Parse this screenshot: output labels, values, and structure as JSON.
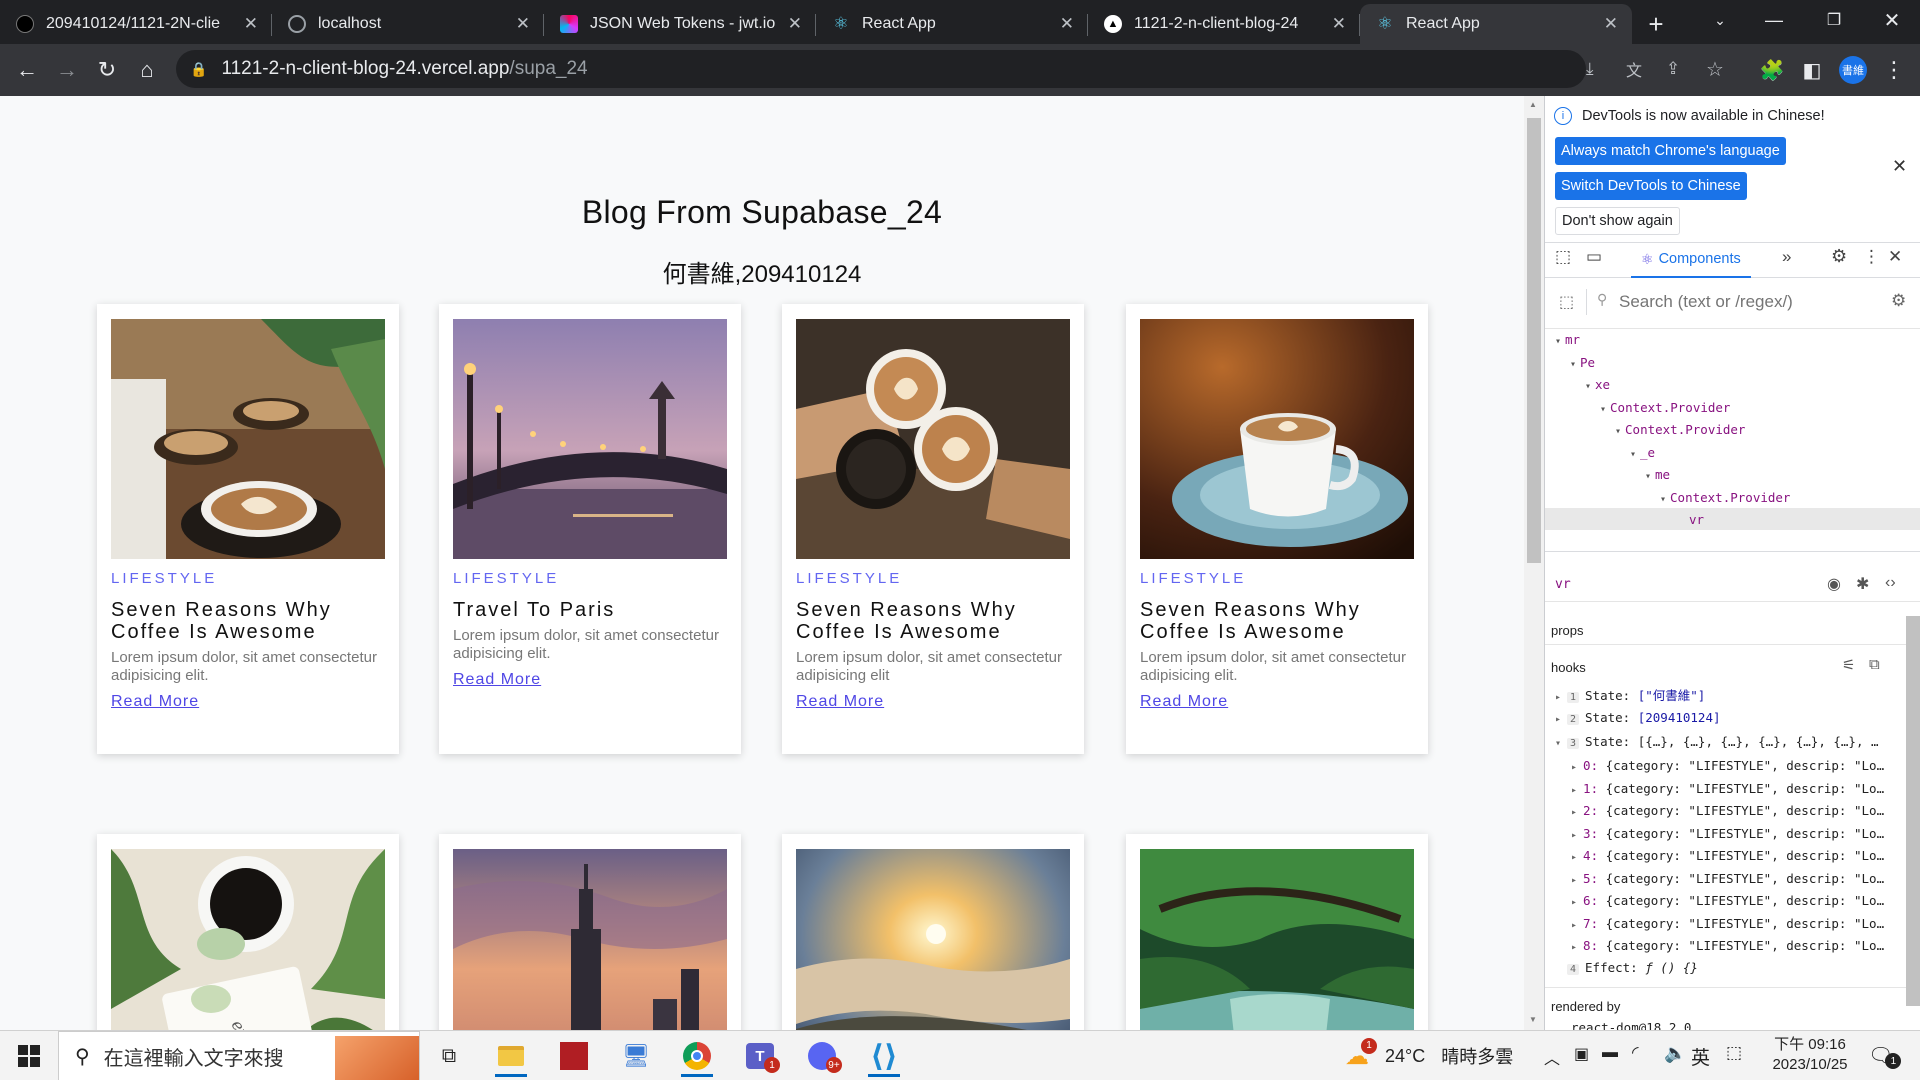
{
  "browser": {
    "tabs": [
      {
        "label": "209410124/1121-2N-clie",
        "icon": "github-icon",
        "active": false
      },
      {
        "label": "localhost",
        "icon": "globe-icon",
        "active": false
      },
      {
        "label": "JSON Web Tokens - jwt.io",
        "icon": "jwt-icon",
        "active": false
      },
      {
        "label": "React App",
        "icon": "react-icon",
        "active": false
      },
      {
        "label": "1121-2-n-client-blog-24",
        "icon": "vercel-icon",
        "active": false
      },
      {
        "label": "React App",
        "icon": "react-icon",
        "active": true
      }
    ],
    "url_host": "1121-2-n-client-blog-24.vercel.app",
    "url_path": "/supa_24",
    "profile_badge": "書維"
  },
  "page": {
    "title": "Blog From Supabase_24",
    "subtitle": "何書維,209410124",
    "cards": [
      {
        "category": "LIFESTYLE",
        "title": "Seven Reasons Why Coffee Is Awesome",
        "desc": "Lorem ipsum dolor, sit amet consectetur adipisicing elit.",
        "link": "Read More",
        "image": "coffee-latte-art"
      },
      {
        "category": "LIFESTYLE",
        "title": "Travel To Paris",
        "desc": "Lorem ipsum dolor, sit amet consectetur adipisicing elit.",
        "link": "Read More",
        "image": "paris-bridge-dusk"
      },
      {
        "category": "LIFESTYLE",
        "title": "Seven Reasons Why Coffee Is Awesome",
        "desc": "Lorem ipsum dolor, sit amet consectetur adipisicing elit",
        "link": "Read More",
        "image": "coffee-cheers"
      },
      {
        "category": "LIFESTYLE",
        "title": "Seven Reasons Why Coffee Is Awesome",
        "desc": "Lorem ipsum dolor, sit amet consectetur adipisicing elit.",
        "link": "Read More",
        "image": "coffee-cup-blue"
      },
      {
        "image": "coffee-leaves"
      },
      {
        "image": "taipei-101-sunset"
      },
      {
        "image": "sunrise-clouds"
      },
      {
        "image": "green-tree-river"
      }
    ]
  },
  "devtools": {
    "banner": "DevTools is now available in Chinese!",
    "btn_match": "Always match Chrome's language",
    "btn_switch": "Switch DevTools to Chinese",
    "btn_dont": "Don't show again",
    "tab_components": "Components",
    "search_placeholder": "Search (text or /regex/)",
    "tree": [
      "mr",
      "Pe",
      "xe",
      "Context.Provider",
      "Context.Provider",
      "_e",
      "me",
      "Context.Provider",
      "vr"
    ],
    "selected": "vr",
    "props_label": "props",
    "hooks_label": "hooks",
    "hooks": [
      {
        "num": "1",
        "label": "State:",
        "value": "[\"何書維\"]"
      },
      {
        "num": "2",
        "label": "State:",
        "value": "[209410124]"
      },
      {
        "num": "3",
        "label": "State:",
        "value": "[{…}, {…}, {…}, {…}, {…}, {…}, …"
      }
    ],
    "items": [
      {
        "key": "0:",
        "value": "{category: \"LIFESTYLE\", descrip: \"Lo…"
      },
      {
        "key": "1:",
        "value": "{category: \"LIFESTYLE\", descrip: \"Lo…"
      },
      {
        "key": "2:",
        "value": "{category: \"LIFESTYLE\", descrip: \"Lo…"
      },
      {
        "key": "3:",
        "value": "{category: \"LIFESTYLE\", descrip: \"Lo…"
      },
      {
        "key": "4:",
        "value": "{category: \"LIFESTYLE\", descrip: \"Lo…"
      },
      {
        "key": "5:",
        "value": "{category: \"LIFESTYLE\", descrip: \"Lo…"
      },
      {
        "key": "6:",
        "value": "{category: \"LIFESTYLE\", descrip: \"Lo…"
      },
      {
        "key": "7:",
        "value": "{category: \"LIFESTYLE\", descrip: \"Lo…"
      },
      {
        "key": "8:",
        "value": "{category: \"LIFESTYLE\", descrip: \"Lo…"
      }
    ],
    "effect": {
      "num": "4",
      "label": "Effect:",
      "value": "ƒ () {}"
    },
    "rendered_by": "rendered by",
    "renderer": "react-dom@18.2.0"
  },
  "taskbar": {
    "search_placeholder": "在這裡輸入文字來搜",
    "weather_temp": "24°C",
    "weather_text": "晴時多雲",
    "ime": "英",
    "time": "下午 09:16",
    "date": "2023/10/25",
    "teams_badge": "1",
    "discord_badge": "9+",
    "weather_badge": "1",
    "notif_badge": "1"
  }
}
